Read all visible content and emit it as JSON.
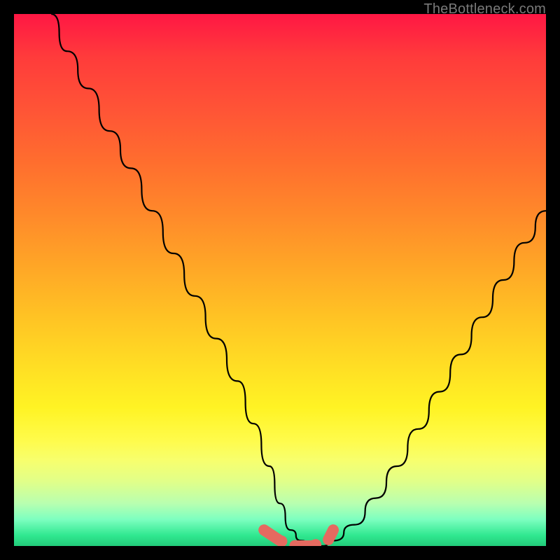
{
  "watermark": "TheBottleneck.com",
  "accent_colors": {
    "curve": "#000000",
    "marker": "#e56a60"
  },
  "chart_data": {
    "type": "line",
    "title": "",
    "xlabel": "",
    "ylabel": "",
    "xlim": [
      0,
      100
    ],
    "ylim": [
      0,
      100
    ],
    "grid": false,
    "legend": false,
    "annotations": [],
    "series": [
      {
        "name": "bottleneck-v-curve",
        "x": [
          7,
          10,
          14,
          18,
          22,
          26,
          30,
          34,
          38,
          42,
          45,
          48,
          50,
          52,
          54,
          56,
          58,
          60,
          64,
          68,
          72,
          76,
          80,
          84,
          88,
          92,
          96,
          100
        ],
        "y": [
          100,
          93,
          86,
          78,
          71,
          63,
          55,
          47,
          39,
          31,
          23,
          15,
          8,
          3,
          1,
          0,
          0,
          1,
          4,
          9,
          15,
          22,
          29,
          36,
          43,
          50,
          57,
          63
        ]
      },
      {
        "name": "optimal-range-markers",
        "x": [
          47,
          50,
          53,
          56,
          59,
          60
        ],
        "y": [
          3,
          1,
          0,
          0,
          1,
          3
        ]
      }
    ]
  }
}
